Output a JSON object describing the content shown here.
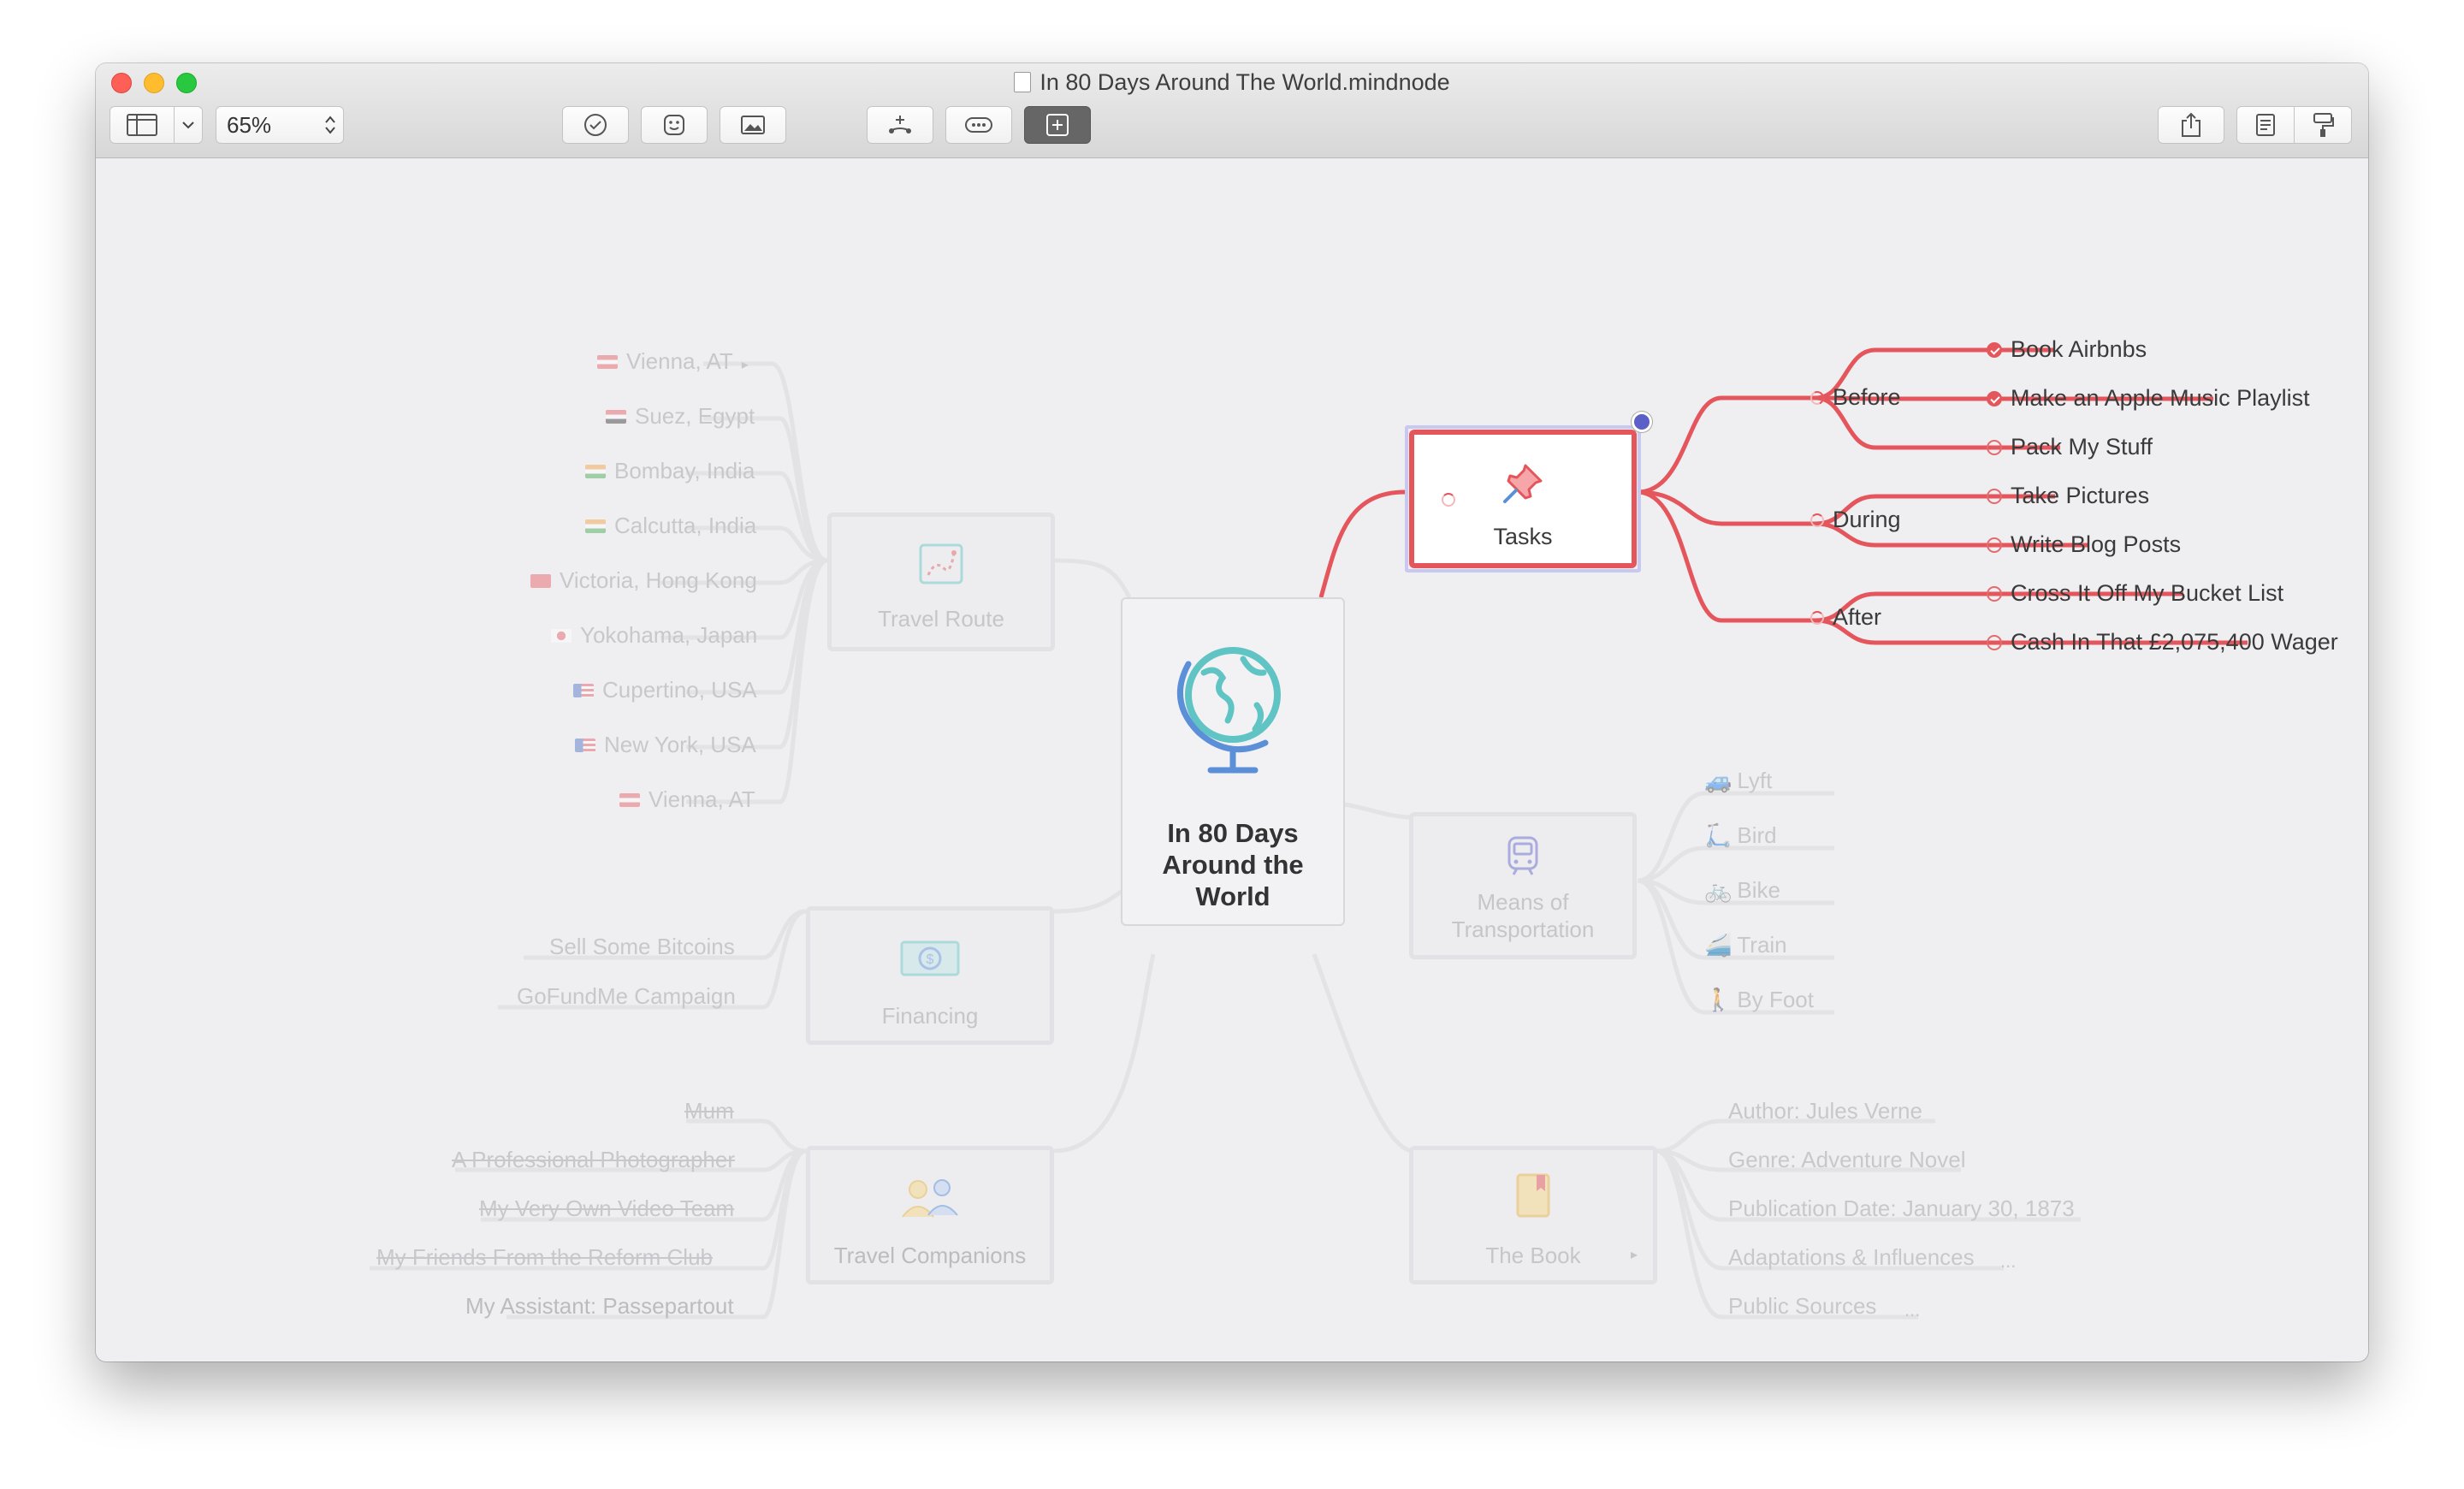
{
  "window": {
    "title": "In 80 Days Around The World.mindnode",
    "zoom": "65%",
    "colors": {
      "close": "#fe5f57",
      "minimize": "#febc2e",
      "maximize": "#28c840",
      "accent": "#e4565c",
      "selection": "#5b5fc7"
    }
  },
  "toolbar": {
    "icons": [
      "sidebar-icon",
      "chevron-down-icon",
      "checkmark-icon",
      "sticker-icon",
      "image-icon",
      "add-child-icon",
      "more-icon",
      "focus-icon",
      "share-icon",
      "notes-icon",
      "format-icon"
    ]
  },
  "central": {
    "title": "In 80 Days Around the World",
    "icon": "globe-icon"
  },
  "tasks": {
    "title": "Tasks",
    "icon": "pushpin-icon",
    "groups": [
      {
        "label": "Before",
        "items": [
          {
            "label": "Book Airbnbs",
            "done": true
          },
          {
            "label": "Make an Apple Music Playlist",
            "done": true
          },
          {
            "label": "Pack My Stuff",
            "done": false
          }
        ]
      },
      {
        "label": "During",
        "items": [
          {
            "label": "Take Pictures",
            "done": false
          },
          {
            "label": "Write Blog Posts",
            "done": false
          }
        ]
      },
      {
        "label": "After",
        "items": [
          {
            "label": "Cross It Off My Bucket List",
            "done": false
          },
          {
            "label": "Cash In That £2,075,400 Wager",
            "done": false
          }
        ]
      }
    ]
  },
  "travel_route": {
    "title": "Travel Route",
    "icon": "map-route-icon",
    "items": [
      "Vienna, AT",
      "Suez, Egypt",
      "Bombay, India",
      "Calcutta, India",
      "Victoria, Hong Kong",
      "Yokohama, Japan",
      "Cupertino, USA",
      "New York, USA",
      "Vienna, AT"
    ]
  },
  "financing": {
    "title": "Financing",
    "icon": "money-icon",
    "items": [
      "Sell Some Bitcoins",
      "GoFundMe Campaign"
    ]
  },
  "companions": {
    "title": "Travel Companions",
    "icon": "people-icon",
    "items": [
      "Mum",
      "A Professional Photographer",
      "My Very Own Video Team",
      "My Friends From the Reform Club",
      "My Assistant: Passepartout"
    ]
  },
  "transport": {
    "title": "Means of Transportation",
    "icon": "train-icon",
    "items": [
      "Lyft",
      "Bird",
      "Bike",
      "Train",
      "By Foot"
    ]
  },
  "book": {
    "title": "The Book",
    "icon": "book-icon",
    "items": [
      "Author: Jules Verne",
      "Genre: Adventure Novel",
      "Publication Date: January 30, 1873",
      "Adaptations & Influences",
      "Public Sources"
    ],
    "more": "..."
  }
}
